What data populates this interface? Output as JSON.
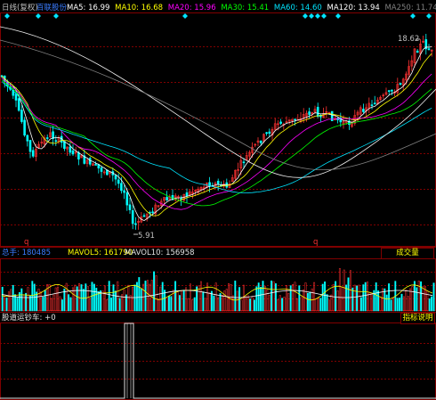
{
  "header": {
    "period_label": "日线(复权)",
    "stock_name": "百联股份",
    "ma_items": [
      {
        "label": "MA5: 16.99",
        "color": "#ffffff"
      },
      {
        "label": "MA10: 16.68",
        "color": "#ffff00"
      },
      {
        "label": "MA20: 15.96",
        "color": "#ff00ff"
      },
      {
        "label": "MA30: 15.41",
        "color": "#00ff00"
      },
      {
        "label": "MA60: 14.60",
        "color": "#00e5ff"
      },
      {
        "label": "MA120: 13.94",
        "color": "#ffffff"
      },
      {
        "label": "MA250: 11.74",
        "color": "#7f7f7f"
      }
    ]
  },
  "price_panel": {
    "high_label": "18.62",
    "low_label": "5.91",
    "marker_glyph": "q"
  },
  "volume_panel": {
    "total_label": "总手: 180485",
    "mavol5_label": "MAVOL5: 161790",
    "mavol10_label": "MAVOL10: 156958",
    "tab_label": "成交量"
  },
  "indicator_panel": {
    "title": "股道运钞车: +0",
    "tab_label": "指标说明"
  },
  "colors": {
    "up": "#ff3232",
    "down": "#00ffff",
    "grid": "#800000",
    "text": "#c0c0c0",
    "ma5": "#ffffff",
    "ma10": "#ffff00",
    "ma20": "#ff00ff",
    "ma30": "#00ff00",
    "ma60": "#00e5ff",
    "ma120": "#f0f0f0",
    "ma250": "#7f7f7f",
    "blue_text": "#3a7cff",
    "tab_text": "#ffff00"
  }
}
